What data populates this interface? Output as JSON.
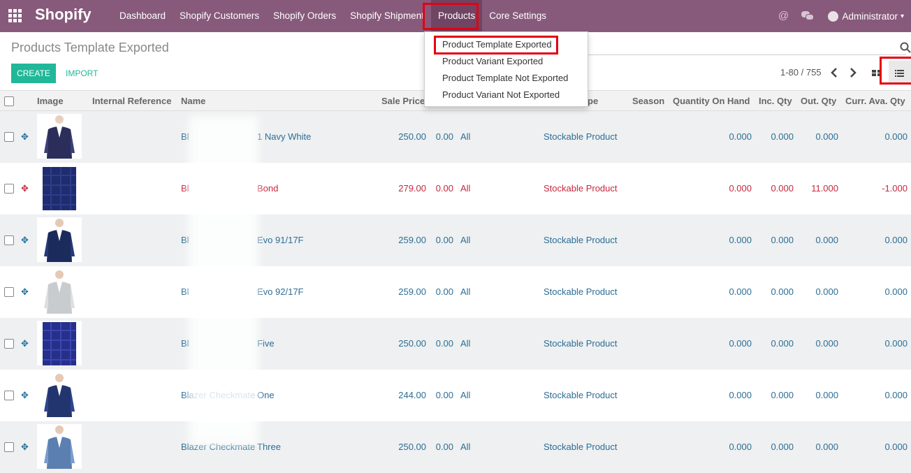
{
  "nav": {
    "brand": "Shopify",
    "menu": [
      "Dashboard",
      "Shopify Customers",
      "Shopify Orders",
      "Shopify Shipment",
      "Products",
      "Core Settings"
    ],
    "user": "Administrator"
  },
  "dropdown": {
    "items": [
      "Product Template Exported",
      "Product Variant Exported",
      "Product Template Not Exported",
      "Product Variant Not Exported"
    ]
  },
  "control": {
    "title": "Products Template Exported",
    "create": "CREATE",
    "import": "IMPORT",
    "pager": "1-80 / 755"
  },
  "table": {
    "headers": [
      "Image",
      "Internal Reference",
      "Name",
      "Sale Price",
      "pe",
      "Season",
      "Quantity On Hand",
      "Inc. Qty",
      "Out. Qty",
      "Curr. Ava. Qty"
    ],
    "rows": [
      {
        "name_a": "Bl",
        "name_b": "1 Navy White",
        "price": "250.00",
        "cost": "0.00",
        "cat": "All",
        "type": "Stockable Product",
        "qoh": "0.000",
        "inc": "0.000",
        "out": "0.000",
        "avail": "0.000",
        "color": "navy"
      },
      {
        "name_a": "Bl",
        "name_b": "Bond",
        "price": "279.00",
        "cost": "0.00",
        "cat": "All",
        "type": "Stockable Product",
        "qoh": "0.000",
        "inc": "0.000",
        "out": "11.000",
        "avail": "-1.000",
        "color": "check"
      },
      {
        "name_a": "Bl",
        "name_b": "Evo 91/17F",
        "price": "259.00",
        "cost": "0.00",
        "cat": "All",
        "type": "Stockable Product",
        "qoh": "0.000",
        "inc": "0.000",
        "out": "0.000",
        "avail": "0.000",
        "color": "navy2"
      },
      {
        "name_a": "Bl",
        "name_b": "Evo 92/17F",
        "price": "259.00",
        "cost": "0.00",
        "cat": "All",
        "type": "Stockable Product",
        "qoh": "0.000",
        "inc": "0.000",
        "out": "0.000",
        "avail": "0.000",
        "color": "grey"
      },
      {
        "name_a": "Bl",
        "name_b": "Five",
        "price": "250.00",
        "cost": "0.00",
        "cat": "All",
        "type": "Stockable Product",
        "qoh": "0.000",
        "inc": "0.000",
        "out": "0.000",
        "avail": "0.000",
        "color": "plaid"
      },
      {
        "name_a": "Blazer Checkmate",
        "name_b": "One",
        "price": "244.00",
        "cost": "0.00",
        "cat": "All",
        "type": "Stockable Product",
        "qoh": "0.000",
        "inc": "0.000",
        "out": "0.000",
        "avail": "0.000",
        "color": "navy3"
      },
      {
        "name_a": "Blazer Checkmate",
        "name_b": "Three",
        "price": "250.00",
        "cost": "0.00",
        "cat": "All",
        "type": "Stockable Product",
        "qoh": "0.000",
        "inc": "0.000",
        "out": "0.000",
        "avail": "0.000",
        "color": "light"
      }
    ]
  },
  "colors": {
    "brand": "#875a7b",
    "accent": "#21b799",
    "link": "#2c6d95",
    "danger": "#c5283d",
    "highlight": "#e4000f"
  }
}
